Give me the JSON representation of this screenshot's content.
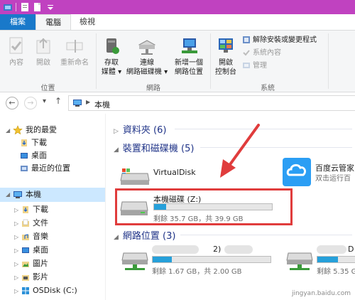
{
  "ribbon": {
    "tabs": [
      "檔案",
      "電腦",
      "檢視"
    ],
    "groups": {
      "location": {
        "label": "位置",
        "buttons": [
          "內容",
          "開啟",
          "重新命名"
        ]
      },
      "network": {
        "label": "網路",
        "buttons": [
          {
            "line1": "存取",
            "line2": "媒體"
          },
          {
            "line1": "連線",
            "line2": "網路磁碟機"
          },
          {
            "line1": "新增一個",
            "line2": "網路位置"
          }
        ]
      },
      "system": {
        "label": "系統",
        "open_cp": {
          "line1": "開啟",
          "line2": "控制台"
        },
        "items": [
          "解除安裝或變更程式",
          "系統內容",
          "管理"
        ]
      }
    }
  },
  "address": {
    "path": "本機"
  },
  "nav": {
    "favorites": "我的最愛",
    "fav_items": [
      "下載",
      "桌面",
      "最近的位置"
    ],
    "thispc": "本機",
    "pc_items": [
      "下載",
      "文件",
      "音樂",
      "桌面",
      "圖片",
      "影片",
      "OSDisk (C:)"
    ]
  },
  "content": {
    "folders": {
      "title": "資料夾 (6)"
    },
    "devices": {
      "title": "裝置和磁碟機 (5)"
    },
    "virtual": {
      "name": "VirtualDisk"
    },
    "baidu": {
      "name": "百度云管家",
      "sub": "双击运行百"
    },
    "local_z": {
      "name": "本機磁碟 (Z:)",
      "free": "剩餘 35.7 GB，共 39.9 GB",
      "used_fraction": 0.105
    },
    "netloc": {
      "title": "網路位置 (3)"
    },
    "net1": {
      "fragment": "2)",
      "free": "剩餘 1.67 GB，共 2.00 GB",
      "used_fraction": 0.165
    },
    "net2": {
      "fragment": "D",
      "free": "剩餘 5.35 G",
      "used_fraction": 0.55
    }
  },
  "watermark": "jingyan.baidu.com"
}
